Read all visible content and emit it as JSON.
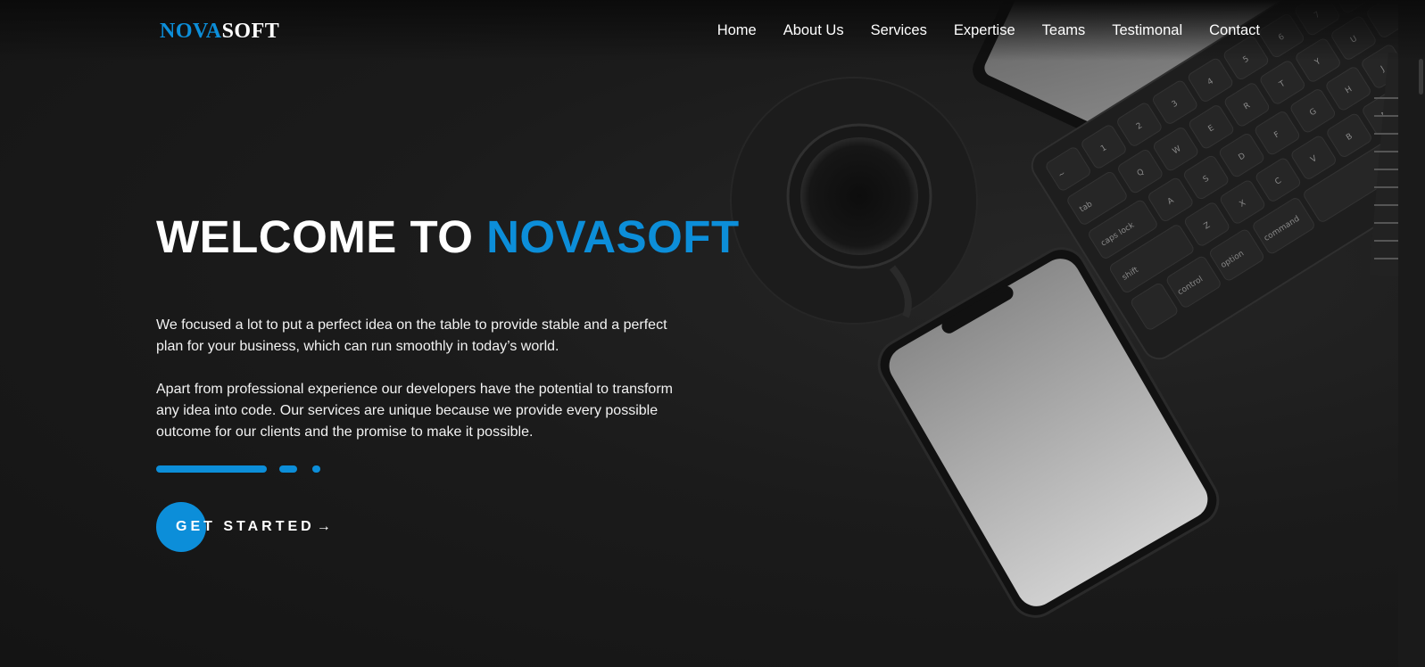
{
  "brand": {
    "part1": "NOVA",
    "part2": "SOFT"
  },
  "nav": {
    "items": [
      "Home",
      "About Us",
      "Services",
      "Expertise",
      "Teams",
      "Testimonal",
      "Contact"
    ]
  },
  "hero": {
    "title_prefix": "WELCOME TO",
    "title_accent": "NOVASOFT",
    "paragraph1": "We focused a lot to put a perfect idea on the table to provide stable and a perfect plan for your business, which can run smoothly in today’s world.",
    "paragraph2": "Apart from professional experience our developers have the potential to transform any idea into code. Our services are unique because we provide every possible outcome for our clients and the promise to make it possible.",
    "cta_label": "GET STARTED",
    "cta_arrow": "→"
  },
  "keyboard_keys": {
    "row1": [
      "~",
      "1",
      "2",
      "3",
      "4",
      "5",
      "6",
      "7"
    ],
    "row2": [
      "tab",
      "Q",
      "W",
      "E",
      "R",
      "T",
      "Y",
      "U"
    ],
    "row3": [
      "caps lock",
      "A",
      "S",
      "D",
      "F",
      "G",
      "H",
      "J"
    ],
    "row4": [
      "shift",
      "Z",
      "X",
      "C",
      "V",
      "B",
      "N"
    ],
    "row5": [
      "control",
      "option",
      "command"
    ]
  },
  "colors": {
    "accent": "#0c8ed9",
    "background": "#1b1b1b",
    "text": "#ffffff"
  }
}
